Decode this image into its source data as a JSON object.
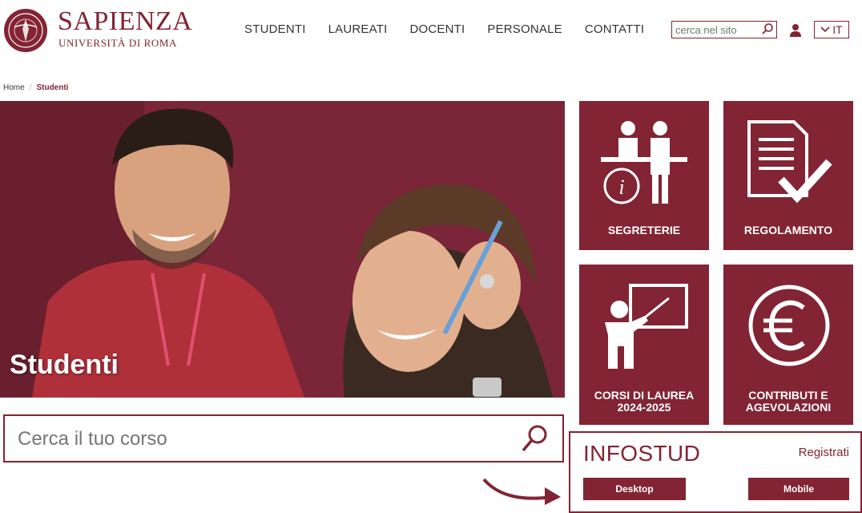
{
  "header": {
    "logo_name": "SAPIENZA",
    "logo_sub": "UNIVERSITÀ DI ROMA",
    "nav": [
      {
        "label": "STUDENTI"
      },
      {
        "label": "LAUREATI"
      },
      {
        "label": "DOCENTI"
      },
      {
        "label": "PERSONALE"
      },
      {
        "label": "CONTATTI"
      }
    ],
    "search_placeholder": "cerca nel sito",
    "language": "IT"
  },
  "breadcrumb": {
    "home": "Home",
    "current": "Studenti"
  },
  "hero": {
    "title": "Studenti"
  },
  "course_search": {
    "placeholder": "Cerca il tuo corso"
  },
  "tiles": [
    {
      "label": "SEGRETERIE",
      "icon": "help-desk-icon"
    },
    {
      "label": "REGOLAMENTO",
      "icon": "document-check-icon"
    },
    {
      "label": "CORSI DI LAUREA 2024-2025",
      "icon": "teacher-icon"
    },
    {
      "label": "CONTRIBUTI E AGEVOLAZIONI",
      "icon": "euro-icon"
    }
  ],
  "infostud": {
    "title": "INFOSTUD",
    "register": "Registrati",
    "desktop": "Desktop",
    "mobile": "Mobile"
  },
  "colors": {
    "brand": "#822433"
  }
}
